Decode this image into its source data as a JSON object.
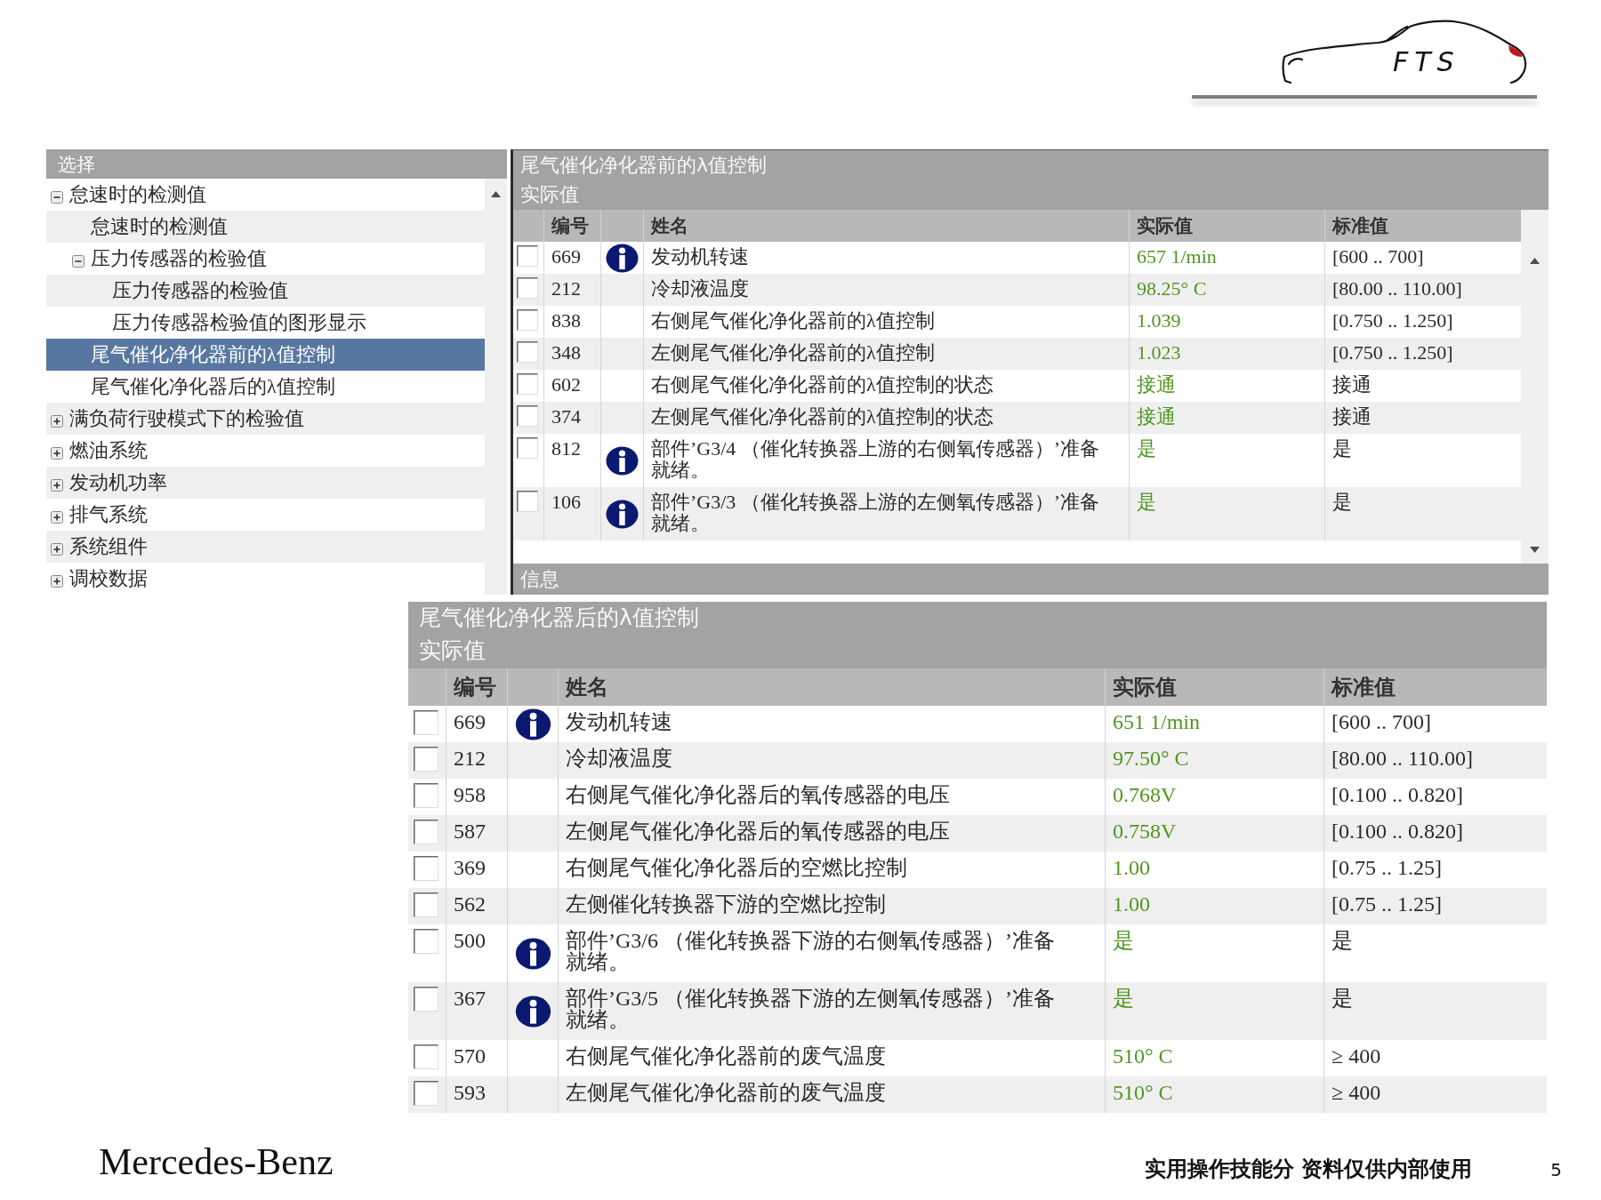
{
  "logo": {
    "text": "FTS"
  },
  "tree": {
    "title": "选择",
    "items": [
      {
        "label": "怠速时的检测值",
        "expanded": true,
        "selected": false,
        "children": [
          {
            "label": "怠速时的检测值",
            "selected": false
          },
          {
            "label": "压力传感器的检验值",
            "expanded": true,
            "selected": false,
            "children": [
              {
                "label": "压力传感器的检验值",
                "selected": false
              },
              {
                "label": "压力传感器检验值的图形显示",
                "selected": false
              }
            ]
          },
          {
            "label": "尾气催化净化器前的λ值控制",
            "selected": true
          },
          {
            "label": "尾气催化净化器后的λ值控制",
            "selected": false
          }
        ]
      },
      {
        "label": "满负荷行驶模式下的检验值",
        "expanded": false,
        "selected": false
      },
      {
        "label": "燃油系统",
        "expanded": false,
        "selected": false
      },
      {
        "label": "发动机功率",
        "expanded": false,
        "selected": false
      },
      {
        "label": "排气系统",
        "expanded": false,
        "selected": false
      },
      {
        "label": "系统组件",
        "expanded": false,
        "selected": false
      },
      {
        "label": "调校数据",
        "expanded": false,
        "selected": false
      }
    ]
  },
  "panels": [
    {
      "title": "尾气催化净化器前的λ值控制",
      "subtitle": "实际值",
      "columns": [
        "编号",
        "姓名",
        "实际值",
        "标准值"
      ],
      "rows": [
        {
          "checked": false,
          "number": "669",
          "info": true,
          "name": "发动机转速",
          "actual": "657 1/min",
          "standard": "[600 .. 700]"
        },
        {
          "checked": false,
          "number": "212",
          "info": false,
          "name": "冷却液温度",
          "actual": "98.25° C",
          "standard": "[80.00 .. 110.00]"
        },
        {
          "checked": false,
          "number": "838",
          "info": false,
          "name": "右侧尾气催化净化器前的λ值控制",
          "actual": "1.039",
          "standard": "[0.750 .. 1.250]"
        },
        {
          "checked": false,
          "number": "348",
          "info": false,
          "name": "左侧尾气催化净化器前的λ值控制",
          "actual": "1.023",
          "standard": "[0.750 .. 1.250]"
        },
        {
          "checked": false,
          "number": "602",
          "info": false,
          "name": "右侧尾气催化净化器前的λ值控制的状态",
          "actual": "接通",
          "standard": "接通"
        },
        {
          "checked": false,
          "number": "374",
          "info": false,
          "name": "左侧尾气催化净化器前的λ值控制的状态",
          "actual": "接通",
          "standard": "接通"
        },
        {
          "checked": false,
          "number": "812",
          "info": true,
          "name": "部件’G3/4 （催化转换器上游的右侧氧传感器）’准备就绪。",
          "actual": "是",
          "standard": "是"
        },
        {
          "checked": false,
          "number": "106",
          "info": true,
          "name": "部件’G3/3 （催化转换器上游的左侧氧传感器）’准备就绪。",
          "actual": "是",
          "standard": "是"
        }
      ],
      "info_bar": "信息"
    },
    {
      "title": "尾气催化净化器后的λ值控制",
      "subtitle": "实际值",
      "columns": [
        "编号",
        "姓名",
        "实际值",
        "标准值"
      ],
      "rows": [
        {
          "checked": false,
          "number": "669",
          "info": true,
          "name": "发动机转速",
          "actual": "651 1/min",
          "standard": "[600 .. 700]"
        },
        {
          "checked": false,
          "number": "212",
          "info": false,
          "name": "冷却液温度",
          "actual": "97.50° C",
          "standard": "[80.00 .. 110.00]"
        },
        {
          "checked": false,
          "number": "958",
          "info": false,
          "name": "右侧尾气催化净化器后的氧传感器的电压",
          "actual": "0.768V",
          "standard": "[0.100 .. 0.820]"
        },
        {
          "checked": false,
          "number": "587",
          "info": false,
          "name": "左侧尾气催化净化器后的氧传感器的电压",
          "actual": "0.758V",
          "standard": "[0.100 .. 0.820]"
        },
        {
          "checked": false,
          "number": "369",
          "info": false,
          "name": "右侧尾气催化净化器后的空燃比控制",
          "actual": "1.00",
          "standard": "[0.75 .. 1.25]"
        },
        {
          "checked": false,
          "number": "562",
          "info": false,
          "name": "左侧催化转换器下游的空燃比控制",
          "actual": "1.00",
          "standard": "[0.75 .. 1.25]"
        },
        {
          "checked": false,
          "number": "500",
          "info": true,
          "name": "部件’G3/6 （催化转换器下游的右侧氧传感器）’准备就绪。",
          "actual": "是",
          "standard": "是"
        },
        {
          "checked": false,
          "number": "367",
          "info": true,
          "name": "部件’G3/5 （催化转换器下游的左侧氧传感器）’准备就绪。",
          "actual": "是",
          "standard": "是"
        },
        {
          "checked": false,
          "number": "570",
          "info": false,
          "name": "右侧尾气催化净化器前的废气温度",
          "actual": "510° C",
          "standard": "≥ 400"
        },
        {
          "checked": false,
          "number": "593",
          "info": false,
          "name": "左侧尾气催化净化器前的废气温度",
          "actual": "510° C",
          "standard": "≥ 400"
        }
      ]
    }
  ],
  "footer": {
    "brand": "Mercedes-Benz",
    "note": "实用操作技能分 资料仅供内部使用",
    "page": "5"
  }
}
